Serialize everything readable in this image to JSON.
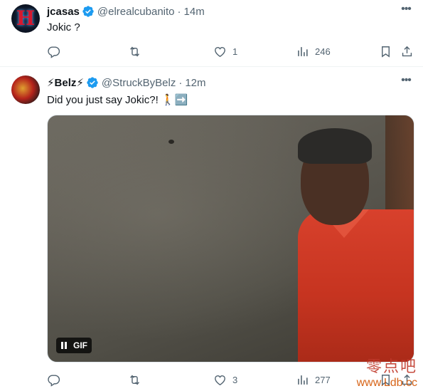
{
  "tweets": [
    {
      "display_name": "jcasas",
      "handle": "@elrealcubanito",
      "separator": "·",
      "time": "14m",
      "text": "Jokic ?",
      "avatar_glyph": "H",
      "metrics": {
        "replies": "",
        "reposts": "",
        "likes": "1",
        "views": "246"
      }
    },
    {
      "display_name": "⚡Belz⚡",
      "handle": "@StruckByBelz",
      "separator": "·",
      "time": "12m",
      "text": "Did you just say Jokic?! 🚶➡️",
      "metrics": {
        "replies": "",
        "reposts": "",
        "likes": "3",
        "views": "277"
      },
      "media": {
        "type": "gif",
        "badge": "GIF"
      }
    }
  ],
  "icons": {
    "verified": "verified-badge-icon",
    "more": "more-options-icon",
    "reply": "reply-icon",
    "repost": "repost-icon",
    "like": "heart-icon",
    "views": "views-chart-icon",
    "bookmark": "bookmark-icon",
    "share": "share-icon"
  },
  "colors": {
    "verified": "#1d9bf0",
    "muted": "#536471",
    "text": "#0f1419",
    "gif_shirt": "#c63420"
  },
  "watermark": {
    "line1": "零点吧",
    "line2": "www.Ldb.cc"
  }
}
